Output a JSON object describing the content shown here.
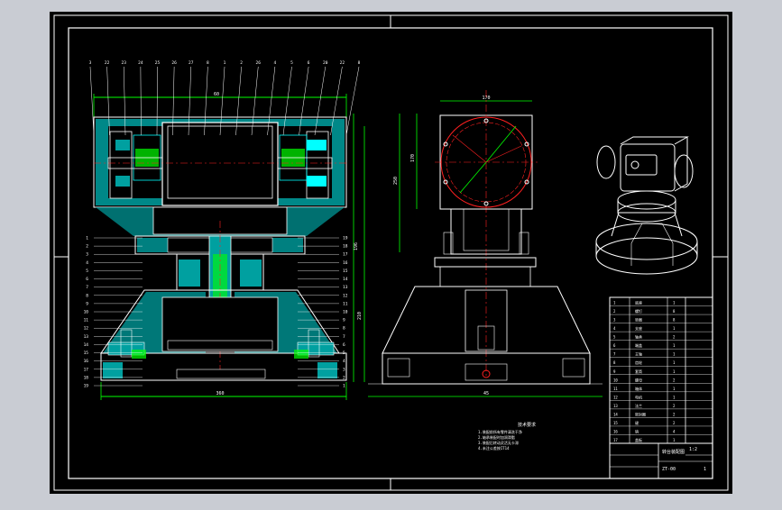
{
  "colors": {
    "background": "#c9ccd3",
    "paper": "#000000",
    "frame": "#ffffff",
    "section_fill": "#00a0a0",
    "cyan": "#00ffff",
    "green": "#00ff00",
    "red": "#ff2020",
    "dimension": "#ffffff"
  },
  "front_view": {
    "top_dim": "60",
    "base_dim": "360",
    "height_dim_outer": "210",
    "height_dim_inner": "196",
    "leader_labels_top": [
      "3",
      "22",
      "23",
      "24",
      "25",
      "26",
      "27",
      "8",
      "1",
      "2",
      "26",
      "4",
      "5",
      "6",
      "20",
      "22",
      "8"
    ],
    "leader_labels_right": [
      "19",
      "18",
      "17",
      "16",
      "15",
      "14",
      "13",
      "12",
      "11",
      "10",
      "9",
      "8",
      "7",
      "6",
      "5",
      "4",
      "3",
      "2",
      "1"
    ]
  },
  "side_view": {
    "top_dim": "170",
    "height_dim_outer": "250",
    "height_dim_inner": "170",
    "base_dim": "45"
  },
  "notes": {
    "title": "技术要求",
    "lines": [
      "1.装配前所有零件清洗干净",
      "2.轴承装配时加润滑脂",
      "3.装配后转动灵活无卡滞",
      "4.未注公差按IT14"
    ]
  },
  "title_block": {
    "part_name": "转台装配图",
    "drawing_no": "ZT-00",
    "scale": "1:2",
    "sheet": "1",
    "items": [
      {
        "no": "1",
        "name": "底座",
        "qty": "1"
      },
      {
        "no": "2",
        "name": "螺钉",
        "qty": "8"
      },
      {
        "no": "3",
        "name": "垫圈",
        "qty": "8"
      },
      {
        "no": "4",
        "name": "支座",
        "qty": "1"
      },
      {
        "no": "5",
        "name": "轴承",
        "qty": "2"
      },
      {
        "no": "6",
        "name": "端盖",
        "qty": "1"
      },
      {
        "no": "7",
        "name": "主轴",
        "qty": "1"
      },
      {
        "no": "8",
        "name": "齿轮",
        "qty": "1"
      },
      {
        "no": "9",
        "name": "套筒",
        "qty": "1"
      },
      {
        "no": "10",
        "name": "螺母",
        "qty": "2"
      },
      {
        "no": "11",
        "name": "箱体",
        "qty": "1"
      },
      {
        "no": "12",
        "name": "电机",
        "qty": "1"
      },
      {
        "no": "13",
        "name": "法兰",
        "qty": "2"
      },
      {
        "no": "14",
        "name": "密封圈",
        "qty": "2"
      },
      {
        "no": "15",
        "name": "键",
        "qty": "2"
      },
      {
        "no": "16",
        "name": "销",
        "qty": "4"
      },
      {
        "no": "17",
        "name": "盖板",
        "qty": "1"
      }
    ]
  }
}
